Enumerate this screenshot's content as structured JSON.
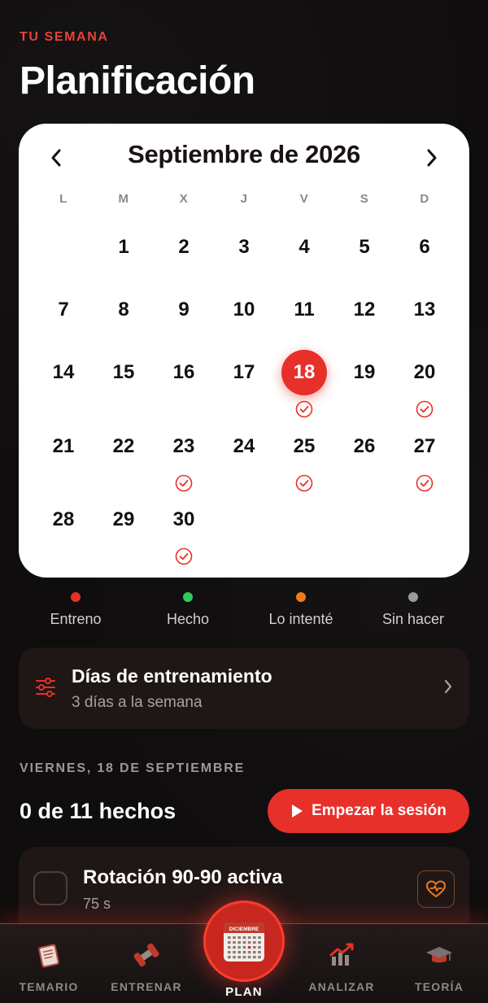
{
  "header": {
    "eyebrow": "TU SEMANA",
    "title": "Planificación"
  },
  "calendar": {
    "month_label": "Septiembre de 2026",
    "weekdays": [
      "L",
      "M",
      "X",
      "J",
      "V",
      "S",
      "D"
    ],
    "days": [
      {
        "num": "1",
        "col": 1,
        "row": 0
      },
      {
        "num": "2",
        "col": 2,
        "row": 0
      },
      {
        "num": "3",
        "col": 3,
        "row": 0
      },
      {
        "num": "4",
        "col": 4,
        "row": 0
      },
      {
        "num": "5",
        "col": 5,
        "row": 0
      },
      {
        "num": "6",
        "col": 6,
        "row": 0
      },
      {
        "num": "7",
        "col": 0,
        "row": 1
      },
      {
        "num": "8",
        "col": 1,
        "row": 1
      },
      {
        "num": "9",
        "col": 2,
        "row": 1
      },
      {
        "num": "10",
        "col": 3,
        "row": 1
      },
      {
        "num": "11",
        "col": 4,
        "row": 1
      },
      {
        "num": "12",
        "col": 5,
        "row": 1
      },
      {
        "num": "13",
        "col": 6,
        "row": 1
      },
      {
        "num": "14",
        "col": 0,
        "row": 2
      },
      {
        "num": "15",
        "col": 1,
        "row": 2
      },
      {
        "num": "16",
        "col": 2,
        "row": 2
      },
      {
        "num": "17",
        "col": 3,
        "row": 2
      },
      {
        "num": "18",
        "col": 4,
        "row": 2,
        "today": true,
        "training": true
      },
      {
        "num": "19",
        "col": 5,
        "row": 2
      },
      {
        "num": "20",
        "col": 6,
        "row": 2,
        "training": true
      },
      {
        "num": "21",
        "col": 0,
        "row": 3
      },
      {
        "num": "22",
        "col": 1,
        "row": 3
      },
      {
        "num": "23",
        "col": 2,
        "row": 3,
        "training": true
      },
      {
        "num": "24",
        "col": 3,
        "row": 3
      },
      {
        "num": "25",
        "col": 4,
        "row": 3,
        "training": true
      },
      {
        "num": "26",
        "col": 5,
        "row": 3
      },
      {
        "num": "27",
        "col": 6,
        "row": 3,
        "training": true
      },
      {
        "num": "28",
        "col": 0,
        "row": 4
      },
      {
        "num": "29",
        "col": 1,
        "row": 4
      },
      {
        "num": "30",
        "col": 2,
        "row": 4,
        "training": true
      }
    ]
  },
  "legend": [
    {
      "label": "Entreno",
      "color": "#e8302a"
    },
    {
      "label": "Hecho",
      "color": "#2ecc5a"
    },
    {
      "label": "Lo intenté",
      "color": "#f07a1a"
    },
    {
      "label": "Sin hacer",
      "color": "#9a9a9a"
    }
  ],
  "training_days": {
    "title": "Días de entrenamiento",
    "subtitle": "3 días a la semana"
  },
  "session": {
    "date_caption": "VIERNES, 18 DE SEPTIEMBRE",
    "progress": "0 de 11 hechos",
    "start_label": "Empezar la sesión"
  },
  "exercise": {
    "title": "Rotación 90-90 activa",
    "duration": "75 s"
  },
  "nav": {
    "items": [
      {
        "label": "TEMARIO",
        "icon": "book-icon"
      },
      {
        "label": "ENTRENAR",
        "icon": "dumbbell-icon"
      },
      {
        "label": "ANALIZAR",
        "icon": "chart-icon"
      },
      {
        "label": "TEORÍA",
        "icon": "graduation-cap-icon"
      }
    ],
    "center": {
      "label": "PLAN",
      "icon": "calendar-icon",
      "icon_text": "DICIEMBRE"
    }
  },
  "colors": {
    "accent": "#e8302a",
    "card": "#1f1716",
    "background": "#0f0d0d"
  }
}
